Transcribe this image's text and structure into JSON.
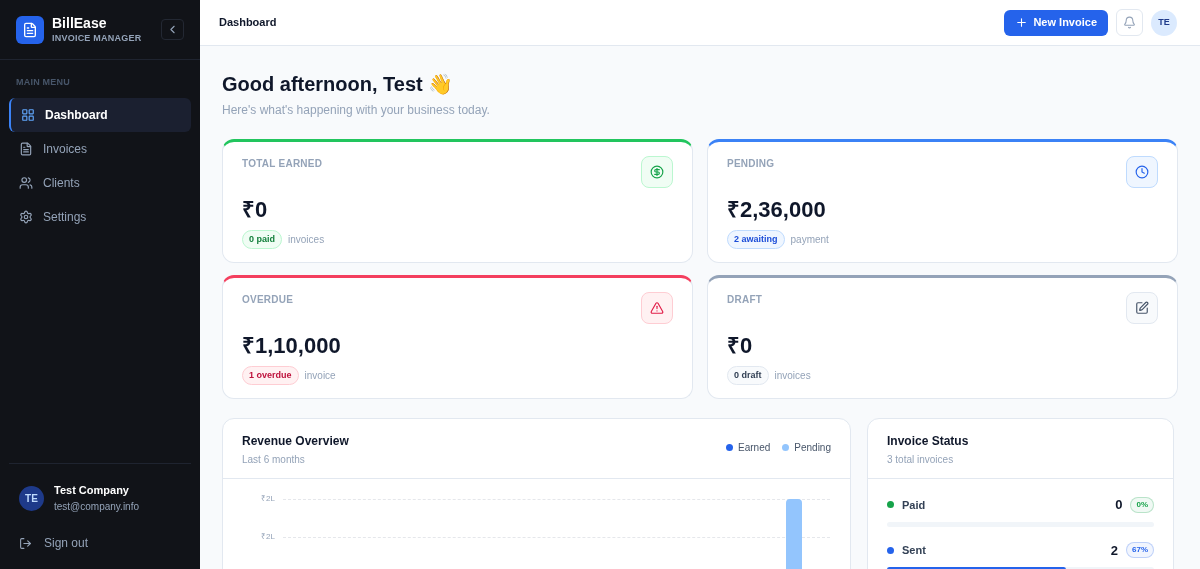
{
  "brand": {
    "name": "BillEase",
    "subtitle": "INVOICE MANAGER"
  },
  "sidebar": {
    "section_label": "MAIN MENU",
    "items": [
      {
        "label": "Dashboard",
        "kind": "dashboard",
        "selected": true
      },
      {
        "label": "Invoices",
        "kind": "invoices",
        "selected": false
      },
      {
        "label": "Clients",
        "kind": "clients",
        "selected": false
      },
      {
        "label": "Settings",
        "kind": "settings",
        "selected": false
      }
    ]
  },
  "user": {
    "initials": "TE",
    "name": "Test Company",
    "email": "test@company.info"
  },
  "sign_out": "Sign out",
  "header": {
    "title": "Dashboard",
    "new_button": "New Invoice",
    "avatar": "TE"
  },
  "greeting": {
    "title": "Good afternoon, Test 👋",
    "subtitle": "Here's what's happening with your business today."
  },
  "stats": [
    {
      "kind": "earned",
      "label": "TOTAL EARNED",
      "value": "₹0",
      "badge": "0 paid",
      "note": "invoices",
      "color": "#22c55e"
    },
    {
      "kind": "pending",
      "label": "PENDING",
      "value": "₹2,36,000",
      "badge": "2 awaiting",
      "note": "payment",
      "color": "#3b82f6"
    },
    {
      "kind": "overdue",
      "label": "OVERDUE",
      "value": "₹1,10,000",
      "badge": "1 overdue",
      "note": "invoice",
      "color": "#f43f5e"
    },
    {
      "kind": "draft",
      "label": "DRAFT",
      "value": "₹0",
      "badge": "0 draft",
      "note": "invoices",
      "color": "#94a3b8"
    }
  ],
  "revenue": {
    "title": "Revenue Overview",
    "subtitle": "Last 6 months",
    "legend": [
      {
        "label": "Earned",
        "color": "#2563eb"
      },
      {
        "label": "Pending",
        "color": "#93c5fd"
      }
    ],
    "axis_labels": [
      "₹2L",
      "₹2L"
    ]
  },
  "status": {
    "title": "Invoice Status",
    "subtitle": "3 total invoices",
    "rows": [
      {
        "label": "Paid",
        "count": "0",
        "percent": "0%",
        "level": 0,
        "color": "#16a34a"
      },
      {
        "label": "Sent",
        "count": "2",
        "percent": "67%",
        "level": 0.67,
        "color": "#2563eb"
      }
    ]
  }
}
